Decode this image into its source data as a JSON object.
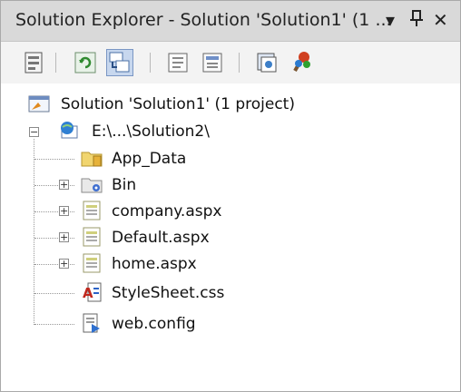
{
  "title": "Solution Explorer - Solution 'Solution1' (1 ...",
  "title_controls": {
    "dropdown": "▾",
    "pin": "⊥",
    "close": "✕"
  },
  "toolbar": {
    "buttons": [
      "properties",
      "refresh",
      "nest-related-files",
      "view-code",
      "view-designer",
      "copy-website",
      "asp-net-configuration"
    ]
  },
  "tree": {
    "solution": "Solution 'Solution1' (1 project)",
    "project": "E:\\...\\Solution2\\",
    "items": [
      {
        "label": "App_Data",
        "icon": "folder-icon",
        "expandable": false
      },
      {
        "label": "Bin",
        "icon": "bin-folder-icon",
        "expandable": true
      },
      {
        "label": "company.aspx",
        "icon": "aspx-page-icon",
        "expandable": true
      },
      {
        "label": "Default.aspx",
        "icon": "aspx-page-icon",
        "expandable": true
      },
      {
        "label": "home.aspx",
        "icon": "aspx-page-icon",
        "expandable": true
      },
      {
        "label": "StyleSheet.css",
        "icon": "stylesheet-icon",
        "expandable": false
      },
      {
        "label": "web.config",
        "icon": "config-file-icon",
        "expandable": false
      }
    ]
  }
}
